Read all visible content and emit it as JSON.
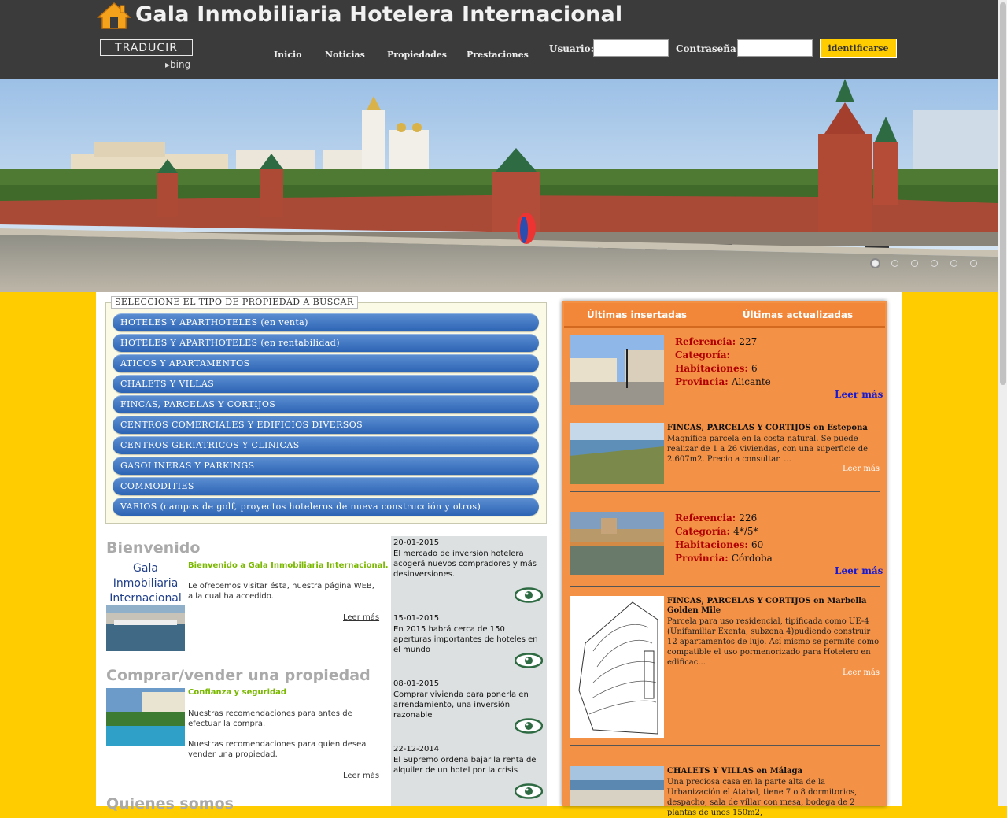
{
  "header": {
    "title": "Gala Inmobiliaria Hotelera Internacional",
    "translate_label": "TRADUCIR",
    "bing_label": "bing",
    "nav": [
      "Inicio",
      "Noticias",
      "Propiedades",
      "Prestaciones"
    ],
    "user_label": "Usuario:",
    "password_label": "Contraseña:",
    "login_button": "identificarse"
  },
  "selector": {
    "legend": "SELECCIONE EL TIPO DE PROPIEDAD A BUSCAR",
    "categories": [
      "HOTELES Y APARTHOTELES (en venta)",
      "HOTELES Y APARTHOTELES (en rentabilidad)",
      "ATICOS Y APARTAMENTOS",
      "CHALETS Y VILLAS",
      "FINCAS, PARCELAS Y CORTIJOS",
      "CENTROS COMERCIALES Y EDIFICIOS DIVERSOS",
      "CENTROS GERIATRICOS Y CLINICAS",
      "GASOLINERAS Y PARKINGS",
      "COMMODITIES",
      "VARIOS (campos de golf, proyectos hoteleros de nueva construcción y otros)"
    ]
  },
  "welcome": {
    "title": "Bienvenido",
    "logo_lines": [
      "Gala",
      "Inmobiliaria",
      "Internacional"
    ],
    "highlight": "Bienvenido a Gala Inmobiliaria Internacional.",
    "text": "Le ofrecemos visitar ésta, nuestra página WEB, a la cual ha accedido.",
    "more": "Leer más"
  },
  "buysell": {
    "title": "Comprar/vender una propiedad",
    "highlight": "Confianza y seguridad",
    "text1": "Nuestras recomendaciones para antes de efectuar la compra.",
    "text2": "Nuestras recomendaciones para quien desea vender una propiedad.",
    "more": "Leer más"
  },
  "about": {
    "title": "Quienes somos"
  },
  "news": [
    {
      "date": "20-01-2015",
      "text": "El mercado de inversión hotelera acogerá nuevos compradores y más desinversiones."
    },
    {
      "date": "15-01-2015",
      "text": "En 2015 habrá cerca de 150 aperturas importantes de hoteles en el mundo"
    },
    {
      "date": "08-01-2015",
      "text": "Comprar vivienda para ponerla en arrendamiento, una inversión razonable"
    },
    {
      "date": "22-12-2014",
      "text": "El Supremo ordena bajar la renta de alquiler de un hotel por la crisis"
    }
  ],
  "panel": {
    "tabs": [
      "Últimas insertadas",
      "Últimas actualizadas"
    ],
    "labels": {
      "ref": "Referencia:",
      "cat": "Categoría:",
      "rooms": "Habitaciones:",
      "prov": "Provincia:"
    },
    "more": "Leer más",
    "p1": {
      "ref": "227",
      "cat": "",
      "rooms": "6",
      "prov": "Alicante"
    },
    "p2": {
      "head": "FINCAS, PARCELAS Y CORTIJOS en Estepona",
      "desc": "Magnífica parcela en la costa natural. Se puede realizar de 1 a 26 viviendas, con una superficie de 2.607m2. Precio a consultar. ..."
    },
    "p3": {
      "ref": "226",
      "cat": "4*/5*",
      "rooms": "60",
      "prov": "Córdoba"
    },
    "p4": {
      "head": "FINCAS, PARCELAS Y CORTIJOS en Marbella Golden Mile",
      "desc": "Parcela para uso residencial, tipificada como UE-4 (Unifamiliar Exenta, subzona 4)pudiendo construir 12 apartamentos de lujo. Así mismo se permite como compatible el uso pormenorizado para Hotelero en edificac..."
    },
    "p5": {
      "head": "CHALETS Y VILLAS en Málaga",
      "desc": "Una preciosa casa en la parte alta de la Urbanización el Atabal, tiene 7 o 8 dormitorios, despacho, sala de villar con mesa, bodega de 2 plantas de unos 150m2,"
    }
  }
}
